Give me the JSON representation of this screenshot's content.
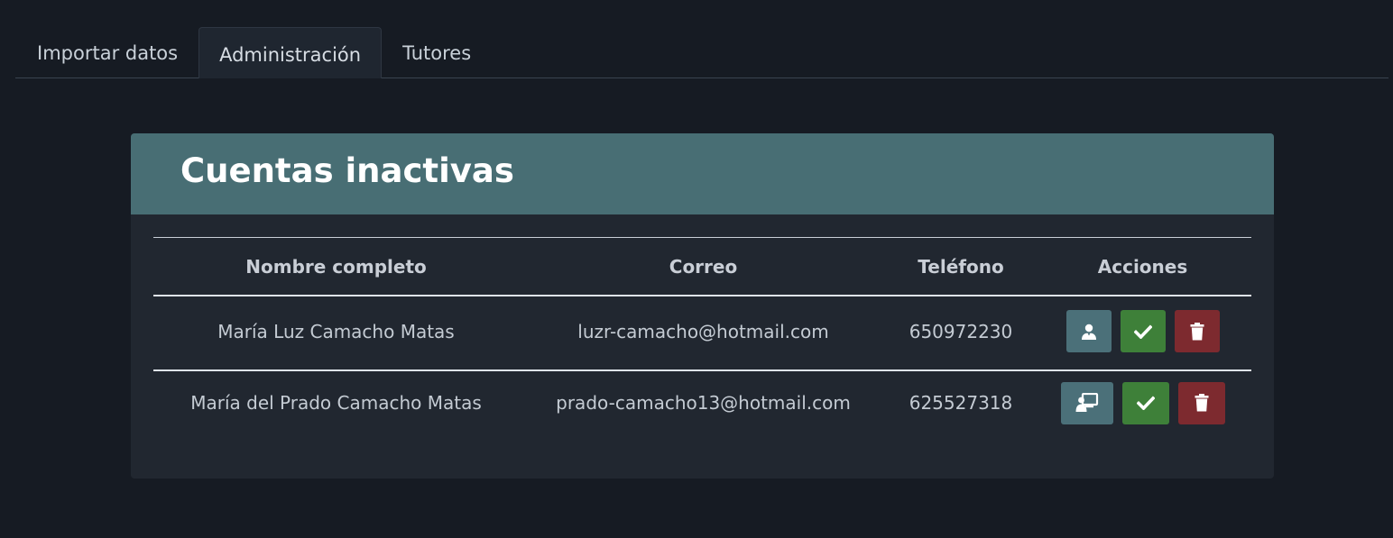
{
  "tabs": [
    {
      "label": "Importar datos",
      "active": false
    },
    {
      "label": "Administración",
      "active": true
    },
    {
      "label": "Tutores",
      "active": false
    }
  ],
  "card": {
    "title": "Cuentas inactivas"
  },
  "table": {
    "headers": {
      "name": "Nombre completo",
      "email": "Correo",
      "phone": "Teléfono",
      "actions": "Acciones"
    },
    "rows": [
      {
        "name": "María Luz Camacho Matas",
        "email": "luzr-camacho@hotmail.com",
        "phone": "650972230",
        "role_icon": "user-icon"
      },
      {
        "name": "María del Prado Camacho Matas",
        "email": "prado-camacho13@hotmail.com",
        "phone": "625527318",
        "role_icon": "teacher-icon"
      }
    ]
  },
  "colors": {
    "background": "#161b23",
    "card_header": "#486e74",
    "card_body": "#212730",
    "role_button": "#4b7079",
    "activate_button": "#3e8039",
    "delete_button": "#7d2a2f"
  }
}
